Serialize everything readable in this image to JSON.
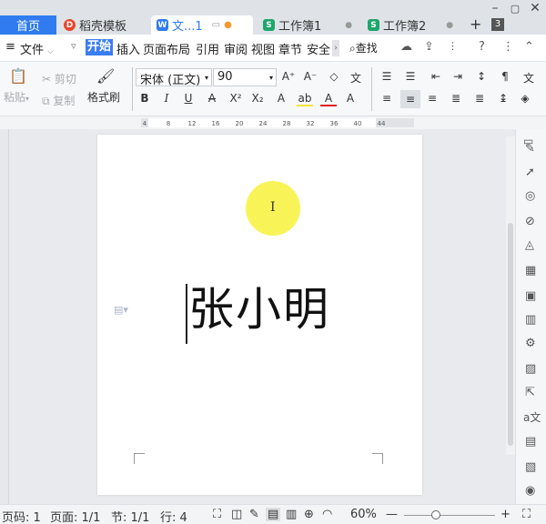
{
  "tabs": {
    "home": "首页",
    "daoke": "稻壳模板",
    "doc": "文...1",
    "sheet1": "工作簿1",
    "sheet2": "工作簿2",
    "count": "3"
  },
  "menu": {
    "file": "文件",
    "items": [
      "开始",
      "插入",
      "页面布局",
      "引用",
      "审阅",
      "视图",
      "章节",
      "安全"
    ],
    "search": "查找"
  },
  "ribbon": {
    "paste": "粘贴",
    "cut": "剪切",
    "copy": "复制",
    "format_painter": "格式刷",
    "font_name": "宋体 (正文)",
    "font_size": "90"
  },
  "ruler": {
    "ticks": [
      "4",
      "4",
      "8",
      "12",
      "16",
      "20",
      "24",
      "28",
      "32",
      "36",
      "40",
      "44"
    ]
  },
  "document": {
    "text": "张小明"
  },
  "status": {
    "page_code": "页码: 1",
    "page": "页面: 1/1",
    "section": "节: 1/1",
    "row": "行: 4",
    "zoom": "60%"
  },
  "colors": {
    "accent": "#3b7df2",
    "highlight": "#f7f23a"
  }
}
